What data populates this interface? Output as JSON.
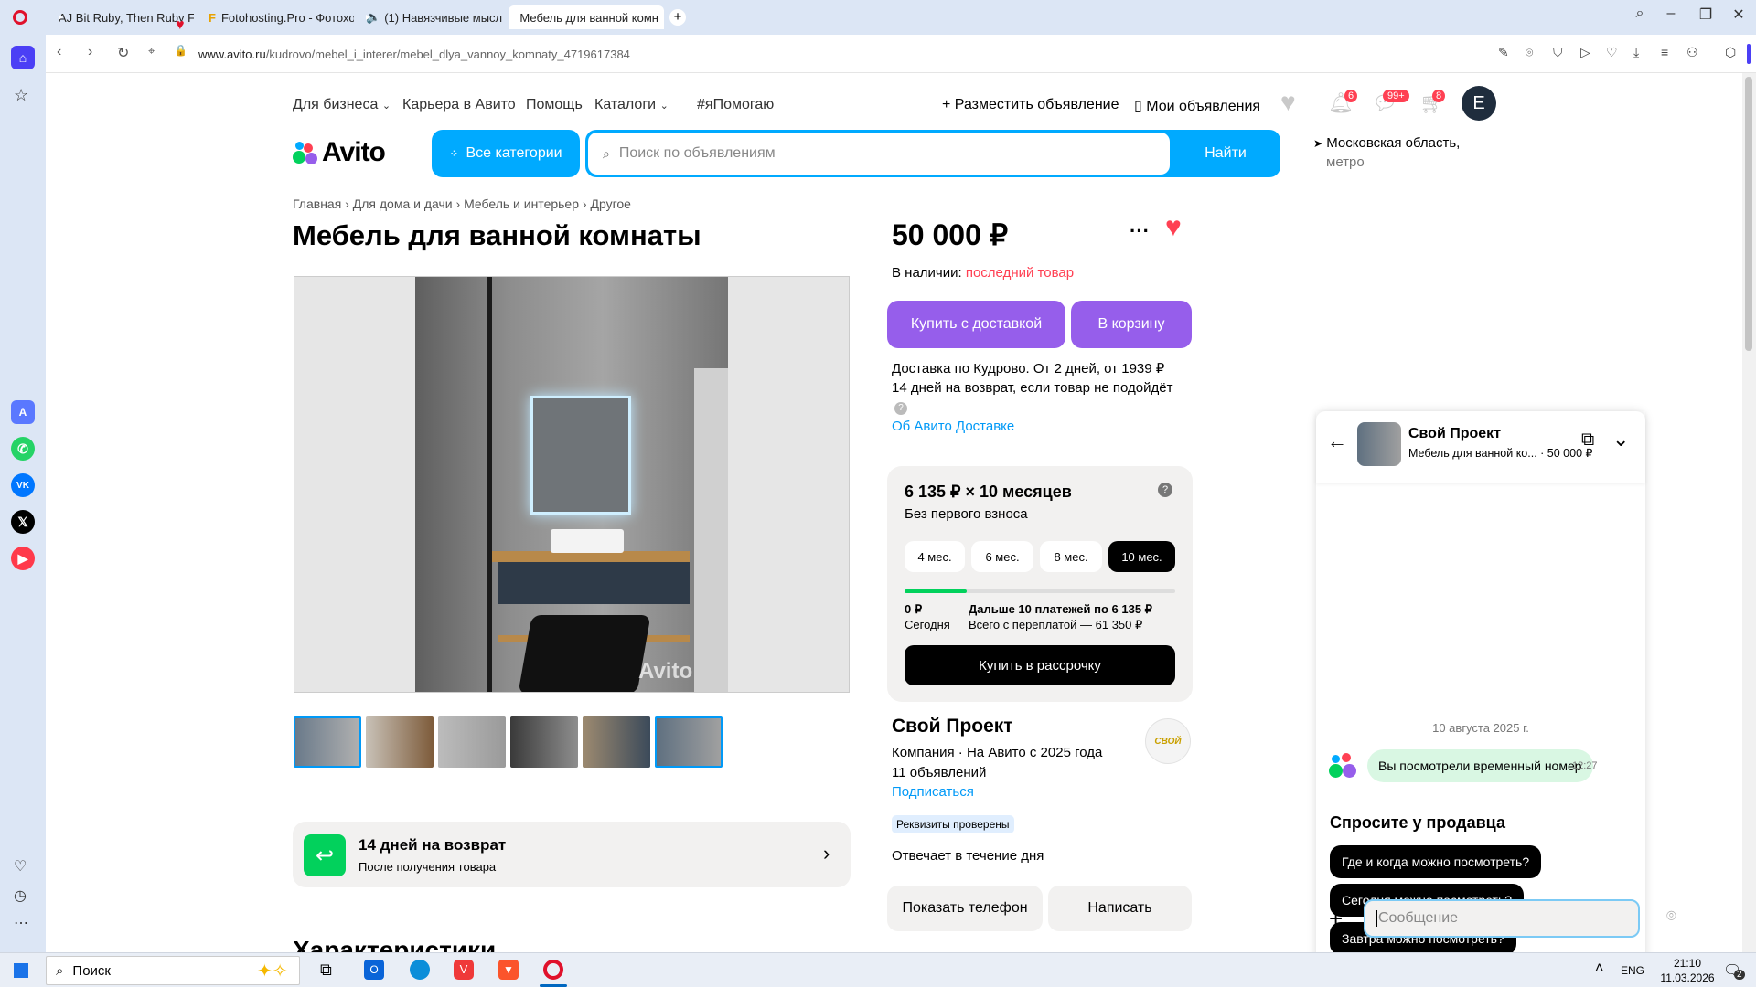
{
  "browser": {
    "tabs": [
      {
        "title": "AJ Bit Ruby, Then Ruby Fo"
      },
      {
        "title": "Fotohosting.Pro - Фотохо"
      },
      {
        "title": "(1) Навязчивые мысл"
      },
      {
        "title": "Мебель для ванной комн"
      }
    ],
    "url_host": "www.avito.ru",
    "url_path": "/kudrovo/mebel_i_interer/mebel_dlya_vannoy_komnaty_4719617384"
  },
  "topnav": {
    "business": "Для бизнеса",
    "career": "Карьера в Авито",
    "help": "Помощь",
    "catalogs": "Каталоги",
    "help_tag": "#яПомогаю",
    "post_ad": "Разместить объявление",
    "my_ads": "Мои объявления",
    "notif_count": "6",
    "msg_count": "99+",
    "cart_count": "8",
    "avatar_letter": "E"
  },
  "header": {
    "logo": "Avito",
    "all_categories": "Все категории",
    "search_placeholder": "Поиск по объявлениям",
    "search_button": "Найти",
    "location": "Московская область,",
    "location_sub": "метро"
  },
  "breadcrumbs": [
    "Главная",
    "Для дома и дачи",
    "Мебель и интерьер",
    "Другое"
  ],
  "listing": {
    "title": "Мебель для ванной комнаты",
    "watermark": "Avito",
    "price": "50 000 ₽",
    "stock_label": "В наличии:",
    "stock_value": "последний товар",
    "buy_delivery": "Купить с доставкой",
    "to_cart": "В корзину",
    "delivery_line1": "Доставка по Кудрово. От 2 дней, от 1939 ₽",
    "delivery_line2": "14 дней на возврат, если товар не подойдёт",
    "delivery_link": "Об Авито Доставке",
    "return_title": "14 дней на возврат",
    "return_sub": "После получения товара",
    "characteristics": "Характеристики"
  },
  "installment": {
    "title": "6 135 ₽ × 10 месяцев",
    "subtitle": "Без первого взноса",
    "options": [
      "4 мес.",
      "6 мес.",
      "8 мес.",
      "10 мес."
    ],
    "today_amount": "0 ₽",
    "today_label": "Сегодня",
    "next_label": "Дальше 10 платежей по 6 135 ₽",
    "total_label": "Всего с переплатой — 61 350 ₽",
    "buy_button": "Купить в рассрочку",
    "progress": 0.23
  },
  "seller": {
    "name": "Свой Проект",
    "info": "Компания · На Авито с 2025 года",
    "ads_count": "11 объявлений",
    "subscribe": "Подписаться",
    "verified": "Реквизиты проверены",
    "response": "Отвечает в течение дня",
    "show_phone": "Показать телефон",
    "write": "Написать",
    "logo_text": "СВОЙ"
  },
  "chat": {
    "seller_name": "Свой Проект",
    "item_title": "Мебель для ванной ко...",
    "item_price": "· 50 000 ₽",
    "date": "10 августа 2025 г.",
    "message": "Вы посмотрели временный номер",
    "message_time": "12:27",
    "ask_title": "Спросите у продавца",
    "questions": [
      "Где и когда можно посмотреть?",
      "Сегодня можно посмотреть?",
      "Завтра можно посмотреть?"
    ],
    "input_placeholder": "Сообщение"
  },
  "taskbar": {
    "search": "Поиск",
    "lang": "ENG",
    "time": "21:10",
    "date": "11.03.2026",
    "notif_count": "2"
  },
  "colors": {
    "avito_blue": "#00aaff",
    "avito_purple": "#965eeb",
    "accent_red": "#ff4053",
    "link_blue": "#0099f7",
    "progress_green": "#02d15c"
  }
}
